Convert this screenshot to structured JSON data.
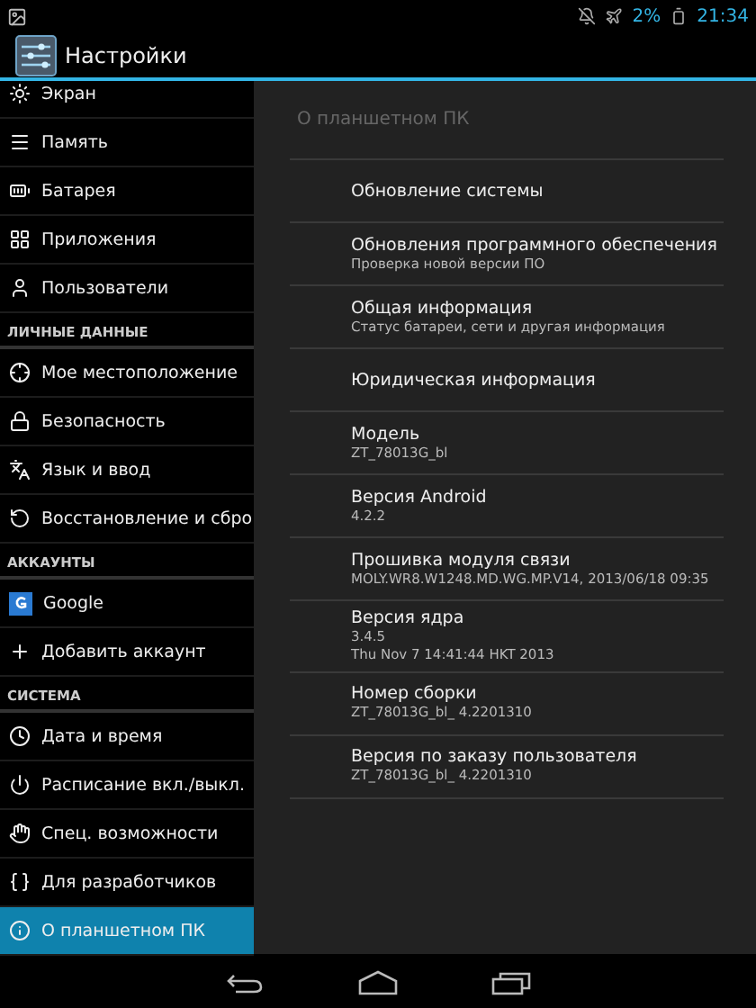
{
  "status_bar": {
    "battery": "2%",
    "time": "21:34"
  },
  "action_bar": {
    "title": "Настройки"
  },
  "sidebar": {
    "items": [
      {
        "kind": "item",
        "label": "Экран",
        "selected": false
      },
      {
        "kind": "item",
        "label": "Память",
        "selected": false
      },
      {
        "kind": "item",
        "label": "Батарея",
        "selected": false
      },
      {
        "kind": "item",
        "label": "Приложения",
        "selected": false
      },
      {
        "kind": "item",
        "label": "Пользователи",
        "selected": false
      },
      {
        "kind": "header",
        "label": "ЛИЧНЫЕ ДАННЫЕ"
      },
      {
        "kind": "item",
        "label": "Мое местоположение",
        "selected": false
      },
      {
        "kind": "item",
        "label": "Безопасность",
        "selected": false
      },
      {
        "kind": "item",
        "label": "Язык и ввод",
        "selected": false
      },
      {
        "kind": "item",
        "label": "Восстановление и сбро",
        "selected": false
      },
      {
        "kind": "header",
        "label": "АККАУНТЫ"
      },
      {
        "kind": "item",
        "label": "Google",
        "selected": false
      },
      {
        "kind": "item",
        "label": "Добавить аккаунт",
        "selected": false
      },
      {
        "kind": "header",
        "label": "СИСТЕМА"
      },
      {
        "kind": "item",
        "label": "Дата и время",
        "selected": false
      },
      {
        "kind": "item",
        "label": "Расписание вкл./выкл.",
        "selected": false
      },
      {
        "kind": "item",
        "label": "Спец. возможности",
        "selected": false
      },
      {
        "kind": "item",
        "label": "Для разработчиков",
        "selected": false
      },
      {
        "kind": "item",
        "label": "О планшетном ПК",
        "selected": true
      }
    ]
  },
  "detail": {
    "header": "О планшетном ПК",
    "items": [
      {
        "title": "Обновление системы"
      },
      {
        "title": "Обновления программного обеспечения",
        "summary": [
          "Проверка новой версии ПО"
        ]
      },
      {
        "title": "Общая информация",
        "summary": [
          "Статус батареи, сети и другая информация"
        ]
      },
      {
        "title": "Юридическая информация"
      },
      {
        "title": "Модель",
        "summary": [
          "ZT_78013G_bl"
        ]
      },
      {
        "title": "Версия Android",
        "summary": [
          "4.2.2"
        ]
      },
      {
        "title": "Прошивка модуля связи",
        "summary": [
          "MOLY.WR8.W1248.MD.WG.MP.V14, 2013/06/18 09:35"
        ]
      },
      {
        "title": "Версия ядра",
        "summary": [
          "3.4.5",
          "Thu Nov 7 14:41:44 HKT 2013"
        ]
      },
      {
        "title": "Номер сборки",
        "summary": [
          "ZT_78013G_bl_ 4.2201310"
        ]
      },
      {
        "title": "Версия по заказу пользователя",
        "summary": [
          "ZT_78013G_bl_ 4.2201310"
        ]
      }
    ]
  }
}
